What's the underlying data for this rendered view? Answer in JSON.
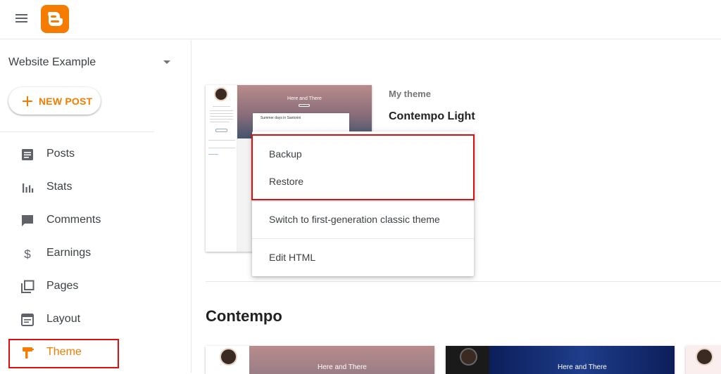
{
  "header": {
    "menu_icon": "hamburger-menu-icon",
    "logo_icon": "blogger-logo-icon",
    "brand_color": "#f57c00"
  },
  "sidebar": {
    "blog_name": "Website Example",
    "new_post_label": "NEW POST",
    "items": [
      {
        "label": "Posts",
        "icon": "posts-icon"
      },
      {
        "label": "Stats",
        "icon": "stats-icon"
      },
      {
        "label": "Comments",
        "icon": "comments-icon"
      },
      {
        "label": "Earnings",
        "icon": "earnings-icon"
      },
      {
        "label": "Pages",
        "icon": "pages-icon"
      },
      {
        "label": "Layout",
        "icon": "layout-icon"
      },
      {
        "label": "Theme",
        "icon": "theme-icon",
        "active": true
      }
    ]
  },
  "main": {
    "my_theme_label": "My theme",
    "current_theme_name": "Contempo Light",
    "preview": {
      "blog_title": "Here and There",
      "post_title": "Summer days in Santorini"
    },
    "menu": {
      "items": [
        "Backup",
        "Restore",
        "Switch to first-generation classic theme",
        "Edit HTML"
      ]
    },
    "section_title": "Contempo",
    "thumbnails": [
      {
        "title": "Here and There"
      },
      {
        "title": "Here and There"
      }
    ]
  },
  "colors": {
    "accent": "#f57c00",
    "highlight_box": "#e10c0c"
  }
}
